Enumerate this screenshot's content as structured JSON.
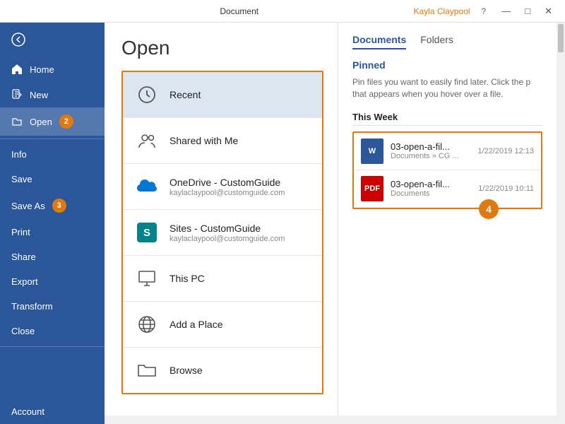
{
  "titlebar": {
    "title": "Document",
    "user": "Kayla Claypool",
    "help": "?",
    "minimize": "—",
    "maximize": "□",
    "close": "✕"
  },
  "sidebar": {
    "back_icon": "←",
    "items": [
      {
        "id": "home",
        "label": "Home",
        "icon": "🏠",
        "active": false
      },
      {
        "id": "new",
        "label": "New",
        "icon": "📄",
        "active": false,
        "badge": null
      },
      {
        "id": "open",
        "label": "Open",
        "icon": "📂",
        "active": true,
        "badge": "2"
      },
      {
        "id": "info",
        "label": "Info",
        "active": false
      },
      {
        "id": "save",
        "label": "Save",
        "active": false
      },
      {
        "id": "save-as",
        "label": "Save As",
        "active": false,
        "badge": "3"
      },
      {
        "id": "print",
        "label": "Print",
        "active": false
      },
      {
        "id": "share",
        "label": "Share",
        "active": false
      },
      {
        "id": "export",
        "label": "Export",
        "active": false
      },
      {
        "id": "transform",
        "label": "Transform",
        "active": false
      },
      {
        "id": "close",
        "label": "Close",
        "active": false
      }
    ],
    "bottom_items": [
      {
        "id": "account",
        "label": "Account"
      }
    ]
  },
  "open_page": {
    "title": "Open",
    "locations": [
      {
        "id": "recent",
        "name": "Recent",
        "icon": "clock",
        "selected": true
      },
      {
        "id": "shared",
        "name": "Shared with Me",
        "icon": "people",
        "selected": false
      },
      {
        "id": "onedrive",
        "name": "OneDrive - CustomGuide",
        "sub": "kaylaclaypool@customguide.com",
        "icon": "cloud",
        "selected": false
      },
      {
        "id": "sites",
        "name": "Sites - CustomGuide",
        "sub": "kaylaclaypool@customguide.com",
        "icon": "sharepoint",
        "selected": false
      },
      {
        "id": "thispc",
        "name": "This PC",
        "icon": "computer",
        "selected": false
      },
      {
        "id": "addplace",
        "name": "Add a Place",
        "icon": "globe",
        "selected": false
      },
      {
        "id": "browse",
        "name": "Browse",
        "icon": "folder",
        "selected": false
      }
    ]
  },
  "right_panel": {
    "tabs": [
      {
        "id": "documents",
        "label": "Documents",
        "active": true
      },
      {
        "id": "folders",
        "label": "Folders",
        "active": false
      }
    ],
    "pinned_label": "Pinned",
    "pinned_desc": "Pin files you want to easily find later. Click the p that appears when you hover over a file.",
    "this_week_label": "This Week",
    "files": [
      {
        "id": "file1",
        "type": "word",
        "icon_label": "W",
        "name": "03-open-a-fil...",
        "path": "Documents » CG ...",
        "date": "1/22/2019 12:13"
      },
      {
        "id": "file2",
        "type": "pdf",
        "icon_label": "PDF",
        "name": "03-open-a-fil...",
        "path": "Documents",
        "date": "1/22/2019 10:11"
      }
    ],
    "badge4_label": "4"
  }
}
